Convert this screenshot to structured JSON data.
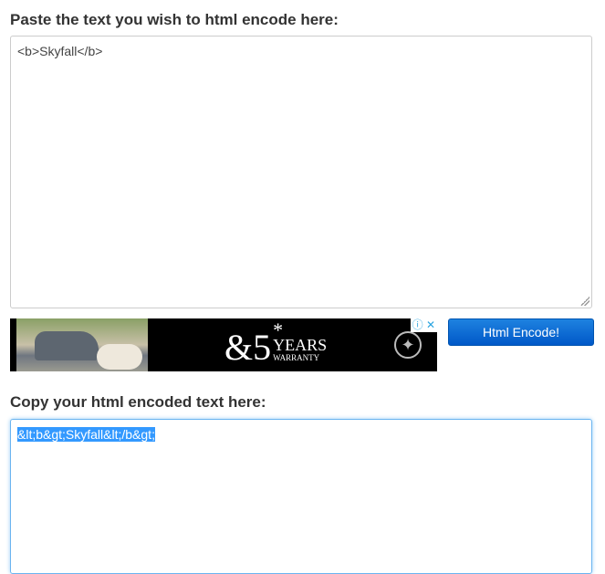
{
  "input_section": {
    "heading": "Paste the text you wish to html encode here:",
    "value": "<b>Skyfall</b>"
  },
  "ad": {
    "big_text": "&5",
    "asterisk": "*",
    "years": "YEARS",
    "warranty": "WARRANTY",
    "info_icon": "info-icon",
    "close_icon": "close-icon"
  },
  "encode_button": {
    "label": "Html Encode!",
    "color": "#0a6ad6"
  },
  "output_section": {
    "heading": "Copy your html encoded text here:",
    "value": "&lt;b&gt;Skyfall&lt;/b&gt;"
  }
}
